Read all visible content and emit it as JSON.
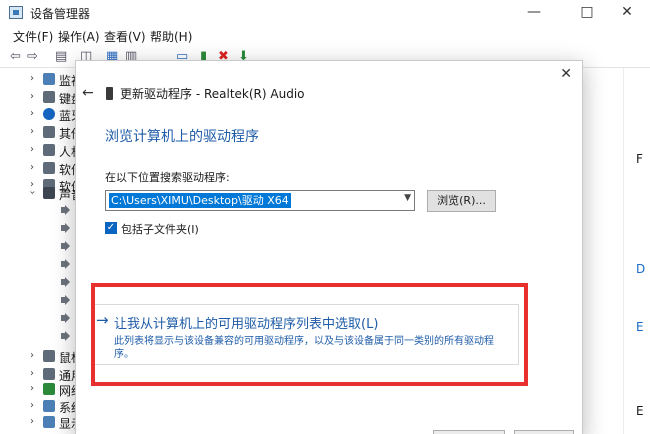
{
  "window": {
    "title": "设备管理器",
    "minimize_icon": "minimize-icon",
    "maximize_icon": "maximize-icon",
    "close_icon": "close-icon"
  },
  "menu": [
    "文件(F)",
    "操作(A)",
    "查看(V)",
    "帮助(H)"
  ],
  "tree": [
    {
      "label": "监视",
      "icon": "monitor-icon"
    },
    {
      "label": "键盘",
      "icon": "keyboard-icon"
    },
    {
      "label": "蓝牙",
      "icon": "bluetooth-icon"
    },
    {
      "label": "其他",
      "icon": "device-icon"
    },
    {
      "label": "人机",
      "icon": "hid-icon"
    },
    {
      "label": "软件",
      "icon": "software-icon"
    },
    {
      "label": "软件",
      "icon": "software-icon"
    },
    {
      "label": "声音",
      "icon": "sound-icon",
      "expanded": true
    },
    {
      "label": "鼠标",
      "icon": "mouse-icon"
    },
    {
      "label": "通用",
      "icon": "usb-icon"
    },
    {
      "label": "网络",
      "icon": "network-icon"
    },
    {
      "label": "系统",
      "icon": "system-icon"
    },
    {
      "label": "显示",
      "icon": "display-icon"
    }
  ],
  "right_strip": {
    "text1": "F",
    "link1": "D",
    "link2": "E",
    "text2": "E"
  },
  "dialog": {
    "header": "更新驱动程序 - Realtek(R) Audio",
    "heading": "浏览计算机上的驱动程序",
    "search_label": "在以下位置搜索驱动程序:",
    "path_value": "C:\\Users\\XIMU\\Desktop\\驱动 X64",
    "browse_label": "浏览(R)...",
    "include_subfolders_label": "包括子文件夹(I)",
    "include_subfolders_checked": true,
    "option": {
      "arrow": "→",
      "title": "让我从计算机上的可用驱动程序列表中选取(L)",
      "desc_line1": "此列表将显示与该设备兼容的可用驱动程序，以及与该设备属于同一类别的所有驱动程",
      "desc_line2": "序。"
    }
  },
  "colors": {
    "accent": "#1f5ca8",
    "selection": "#0078d7",
    "highlight": "#e8312f"
  }
}
